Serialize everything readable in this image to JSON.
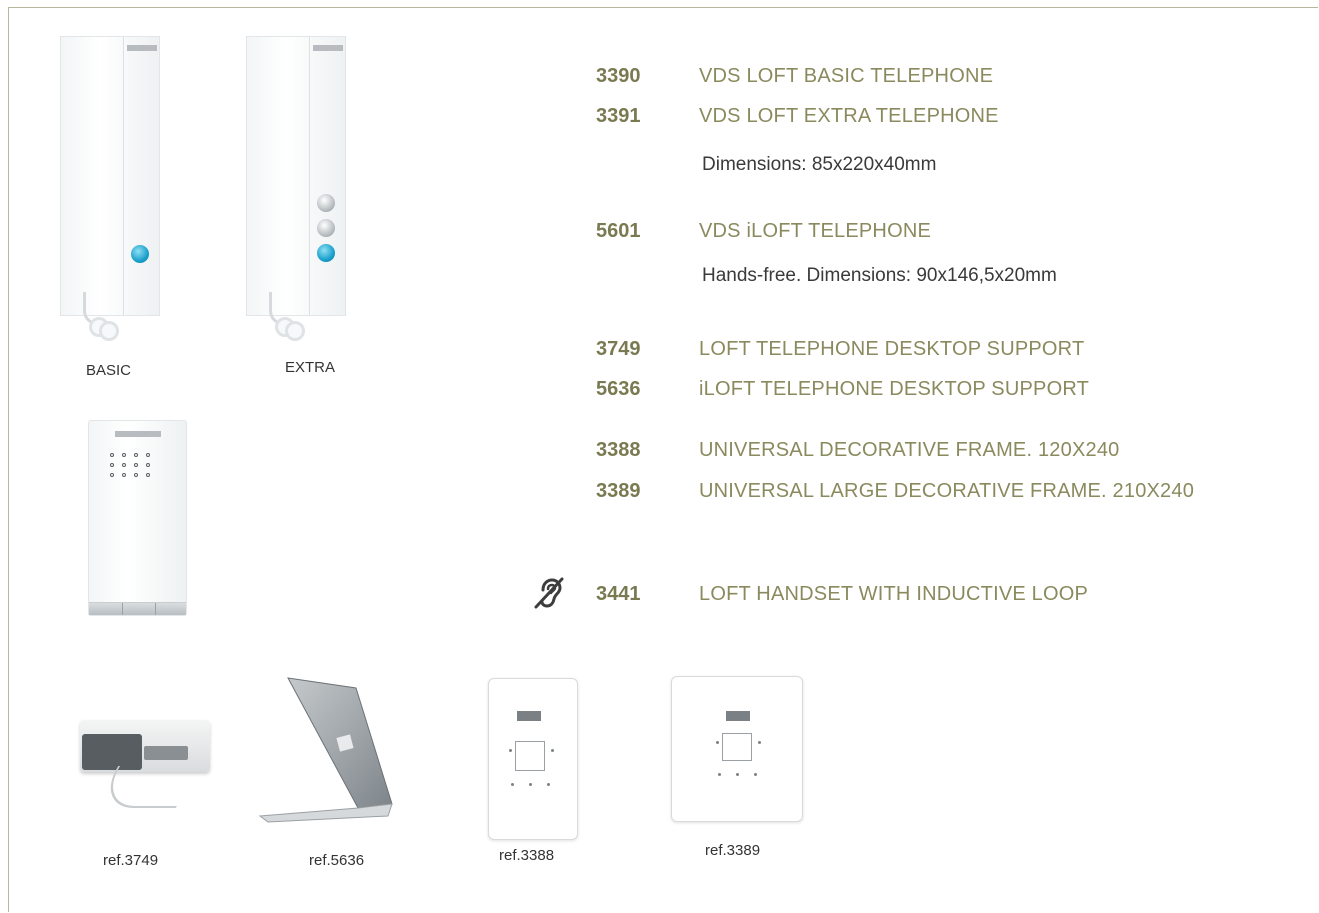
{
  "captions": {
    "basic": "BASIC",
    "extra": "EXTRA",
    "ref3749": "ref.3749",
    "ref5636": "ref.5636",
    "ref3388": "ref.3388",
    "ref3389": "ref.3389"
  },
  "products": [
    {
      "code": "3390",
      "name": "VDS LOFT BASIC TELEPHONE"
    },
    {
      "code": "3391",
      "name": "VDS LOFT EXTRA TELEPHONE"
    },
    {
      "code": "5601",
      "name": "VDS iLOFT TELEPHONE"
    },
    {
      "code": "3749",
      "name": "LOFT TELEPHONE DESKTOP SUPPORT"
    },
    {
      "code": "5636",
      "name": "iLOFT TELEPHONE DESKTOP SUPPORT"
    },
    {
      "code": "3388",
      "name": "UNIVERSAL DECORATIVE FRAME. 120X240"
    },
    {
      "code": "3389",
      "name": "UNIVERSAL LARGE DECORATIVE FRAME. 210X240"
    },
    {
      "code": "3441",
      "name": "LOFT HANDSET WITH INDUCTIVE LOOP"
    }
  ],
  "notes": {
    "loft_dimensions": "Dimensions: 85x220x40mm",
    "iloft_dimensions": "Hands-free. Dimensions: 90x146,5x20mm"
  },
  "icons": {
    "hearing_loop": "hearing-loop-icon"
  },
  "colors": {
    "code": "#7a7a52",
    "name": "#8a8a5e",
    "border": "#b9b79a"
  }
}
